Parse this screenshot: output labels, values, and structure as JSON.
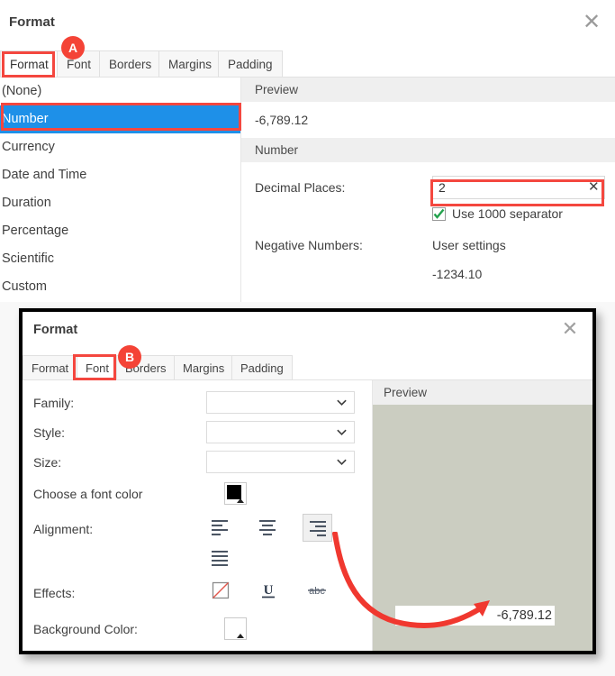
{
  "top_dialog": {
    "title": "Format",
    "close_icon": "close-icon",
    "tabs": [
      {
        "label": "Format",
        "active": true
      },
      {
        "label": "Font",
        "active": false
      },
      {
        "label": "Borders",
        "active": false
      },
      {
        "label": "Margins",
        "active": false
      },
      {
        "label": "Padding",
        "active": false
      }
    ],
    "format_list": [
      {
        "label": "(None)",
        "selected": false
      },
      {
        "label": "Number",
        "selected": true
      },
      {
        "label": "Currency",
        "selected": false
      },
      {
        "label": "Date and Time",
        "selected": false
      },
      {
        "label": "Duration",
        "selected": false
      },
      {
        "label": "Percentage",
        "selected": false
      },
      {
        "label": "Scientific",
        "selected": false
      },
      {
        "label": "Custom",
        "selected": false
      }
    ],
    "preview": {
      "header": "Preview",
      "value": "-6,789.12"
    },
    "number_section": {
      "header": "Number",
      "decimal_places_label": "Decimal Places:",
      "decimal_places_value": "2",
      "decimal_places_clear_icon": "clear-icon",
      "separator_label": "Use 1000 separator",
      "separator_checked": true,
      "negative_numbers_label": "Negative Numbers:",
      "negative_numbers_value": "User settings",
      "negative_numbers_sample": "-1234.10"
    }
  },
  "bottom_dialog": {
    "title": "Format",
    "close_icon": "close-icon",
    "tabs": [
      {
        "label": "Format",
        "active": false
      },
      {
        "label": "Font",
        "active": true
      },
      {
        "label": "Borders",
        "active": false
      },
      {
        "label": "Margins",
        "active": false
      },
      {
        "label": "Padding",
        "active": false
      }
    ],
    "fields": {
      "family_label": "Family:",
      "family_value": "",
      "style_label": "Style:",
      "style_value": "",
      "size_label": "Size:",
      "size_value": "",
      "font_color_label": "Choose a font color",
      "font_color_value": "#000000",
      "alignment_label": "Alignment:",
      "alignment_options": [
        "align-left-icon",
        "align-center-icon",
        "align-right-icon",
        "align-justify-icon"
      ],
      "alignment_selected": "align-right-icon",
      "effects_label": "Effects:",
      "effects_options": [
        "no-effect-icon",
        "underline-icon",
        "strikethrough-icon"
      ],
      "background_color_label": "Background Color:",
      "background_color_value": "#ffffff"
    },
    "preview": {
      "header": "Preview",
      "canvas_color": "#cbcdc1",
      "field_value": "-6,789.12"
    }
  },
  "annotations": {
    "badges": [
      {
        "label": "A",
        "target": "font-tab-top-dialog"
      },
      {
        "label": "B",
        "target": "font-tab-bottom-dialog"
      }
    ],
    "highlight_color": "#f4473f",
    "arrow_color": "#f0382f"
  }
}
